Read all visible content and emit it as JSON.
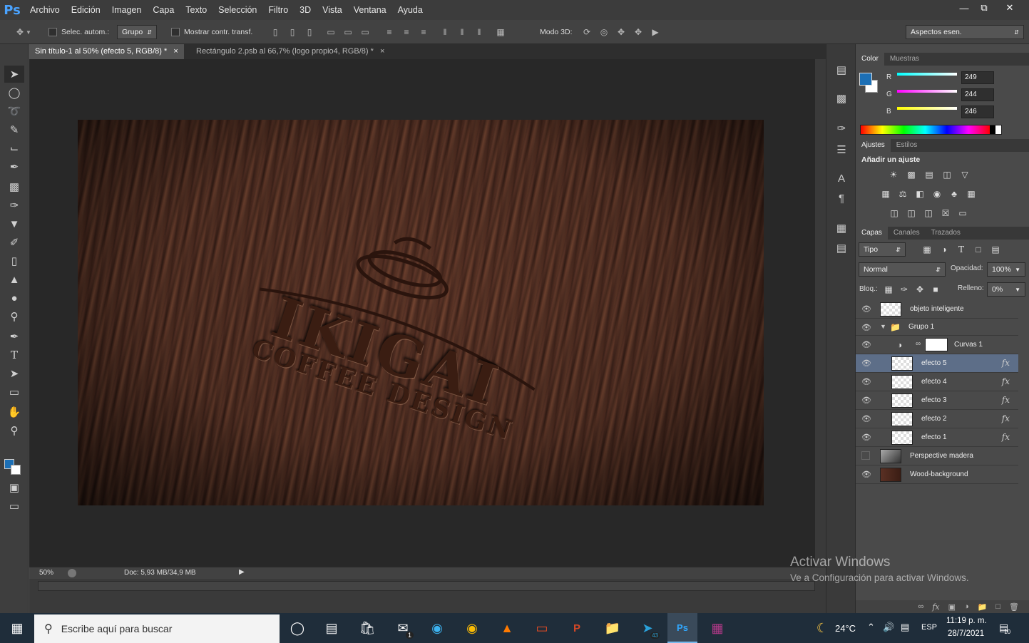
{
  "menubar": {
    "logo": "Ps",
    "items": [
      "Archivo",
      "Edición",
      "Imagen",
      "Capa",
      "Texto",
      "Selección",
      "Filtro",
      "3D",
      "Vista",
      "Ventana",
      "Ayuda"
    ],
    "window_controls": [
      "minimize",
      "restore",
      "close"
    ]
  },
  "options": {
    "auto_select_label": "Selec. autom.:",
    "auto_select_value": "Grupo",
    "show_transform_label": "Mostrar contr. transf.",
    "mode3d_label": "Modo 3D:",
    "workspace": "Aspectos esen."
  },
  "doc_tabs": [
    {
      "label": "Sin título-1 al 50% (efecto 5, RGB/8) *",
      "close": "×"
    },
    {
      "label": "Rectángulo 2.psb al 66,7% (logo propio4, RGB/8) *",
      "close": "×"
    }
  ],
  "canvas": {
    "logo_word": "IKIGAI",
    "logo_sub": "COFFEE DESIGN"
  },
  "status": {
    "zoom": "50%",
    "doc": "Doc: 5,93 MB/34,9 MB"
  },
  "color_panel": {
    "tabs": [
      "Color",
      "Muestras"
    ],
    "r_label": "R",
    "r_value": "249",
    "g_label": "G",
    "g_value": "244",
    "b_label": "B",
    "b_value": "246",
    "fg": "#1c6fb5",
    "bg": "#ffffff"
  },
  "adjust_panel": {
    "tabs": [
      "Ajustes",
      "Estilos"
    ],
    "heading": "Añadir un ajuste"
  },
  "layers_panel": {
    "tabs": [
      "Capas",
      "Canales",
      "Trazados"
    ],
    "filter_kind": "Tipo",
    "blend_mode": "Normal",
    "opacity_label": "Opacidad:",
    "opacity_value": "100%",
    "lock_label": "Bloq.:",
    "fill_label": "Relleno:",
    "fill_value": "0%",
    "layers": [
      {
        "name": "objeto inteligente"
      },
      {
        "name": "Grupo 1"
      },
      {
        "name": "Curvas 1"
      },
      {
        "name": "efecto 5"
      },
      {
        "name": "efecto 4"
      },
      {
        "name": "efecto 3"
      },
      {
        "name": "efecto 2"
      },
      {
        "name": "efecto 1"
      },
      {
        "name": "Perspective madera"
      },
      {
        "name": "Wood-background"
      }
    ],
    "fx_label": "fx"
  },
  "watermark": {
    "title": "Activar Windows",
    "subtitle": "Ve a Configuración para activar Windows."
  },
  "taskbar": {
    "search_placeholder": "Escribe aquí para buscar",
    "temperature": "24°C",
    "language": "ESP",
    "time": "11:19 p. m.",
    "date": "28/7/2021",
    "notifications": "10",
    "mail_badge": "1",
    "telegram_badge": "43"
  }
}
